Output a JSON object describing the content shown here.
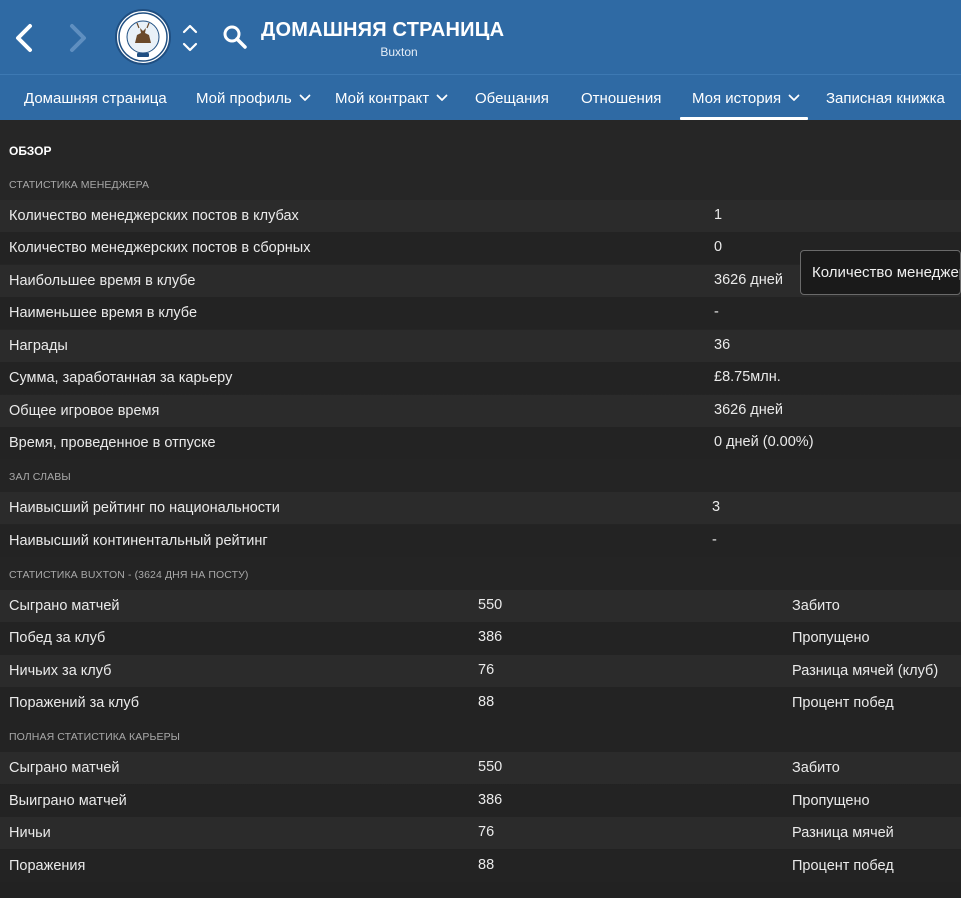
{
  "header": {
    "title": "ДОМАШНЯЯ СТРАНИЦА",
    "subtitle": "Buxton",
    "crest_text": "BUXTON FOOTBALL CLUB",
    "crest_year": "1877",
    "accent_color": "#2f6aa4"
  },
  "tabs": [
    {
      "label": "Домашняя страница",
      "has_dropdown": false
    },
    {
      "label": "Мой профиль",
      "has_dropdown": true
    },
    {
      "label": "Мой контракт",
      "has_dropdown": true
    },
    {
      "label": "Обещания",
      "has_dropdown": false
    },
    {
      "label": "Отношения",
      "has_dropdown": false
    },
    {
      "label": "Моя история",
      "has_dropdown": true,
      "active": true
    },
    {
      "label": "Записная книжка",
      "has_dropdown": false
    }
  ],
  "content": {
    "section_title": "ОБЗОР",
    "manager_stats": {
      "header": "СТАТИСТИКА МЕНЕДЖЕРА",
      "rows": [
        {
          "label": "Количество менеджерских постов в клубах",
          "value": "1"
        },
        {
          "label": "Количество менеджерских постов в сборных",
          "value": "0"
        },
        {
          "label": "Наибольшее время в клубе",
          "value": "3626 дней"
        },
        {
          "label": "Наименьшее время в клубе",
          "value": "-"
        },
        {
          "label": "Награды",
          "value": "36"
        },
        {
          "label": "Сумма, заработанная за карьеру",
          "value": "£8.75млн."
        },
        {
          "label": "Общее игровое время",
          "value": "3626 дней"
        },
        {
          "label": "Время, проведенное в отпуске",
          "value": "0 дней (0.00%)"
        }
      ]
    },
    "hall_of_fame": {
      "header": "ЗАЛ СЛАВЫ",
      "rows": [
        {
          "label": "Наивысший рейтинг по национальности",
          "value": "3"
        },
        {
          "label": "Наивысший континентальный рейтинг",
          "value": "-"
        }
      ]
    },
    "club_stats": {
      "header": "СТАТИСТИКА BUXTON - (3624 ДНЯ НА ПОСТУ)",
      "rows": [
        {
          "label": "Сыграно матчей",
          "value": "550",
          "label2": "Забито"
        },
        {
          "label": "Побед за клуб",
          "value": "386",
          "label2": "Пропущено"
        },
        {
          "label": "Ничьих за клуб",
          "value": "76",
          "label2": "Разница мячей (клуб)"
        },
        {
          "label": "Поражений за клуб",
          "value": "88",
          "label2": "Процент побед"
        }
      ]
    },
    "career_stats": {
      "header": "ПОЛНАЯ СТАТИСТИКА КАРЬЕРЫ",
      "rows": [
        {
          "label": "Сыграно матчей",
          "value": "550",
          "label2": "Забито"
        },
        {
          "label": "Выиграно матчей",
          "value": "386",
          "label2": "Пропущено"
        },
        {
          "label": "Ничьи",
          "value": "76",
          "label2": "Разница мячей"
        },
        {
          "label": "Поражения",
          "value": "88",
          "label2": "Процент побед"
        }
      ]
    }
  },
  "tooltip": {
    "text": "Количество менеджерских постов в сборных"
  }
}
